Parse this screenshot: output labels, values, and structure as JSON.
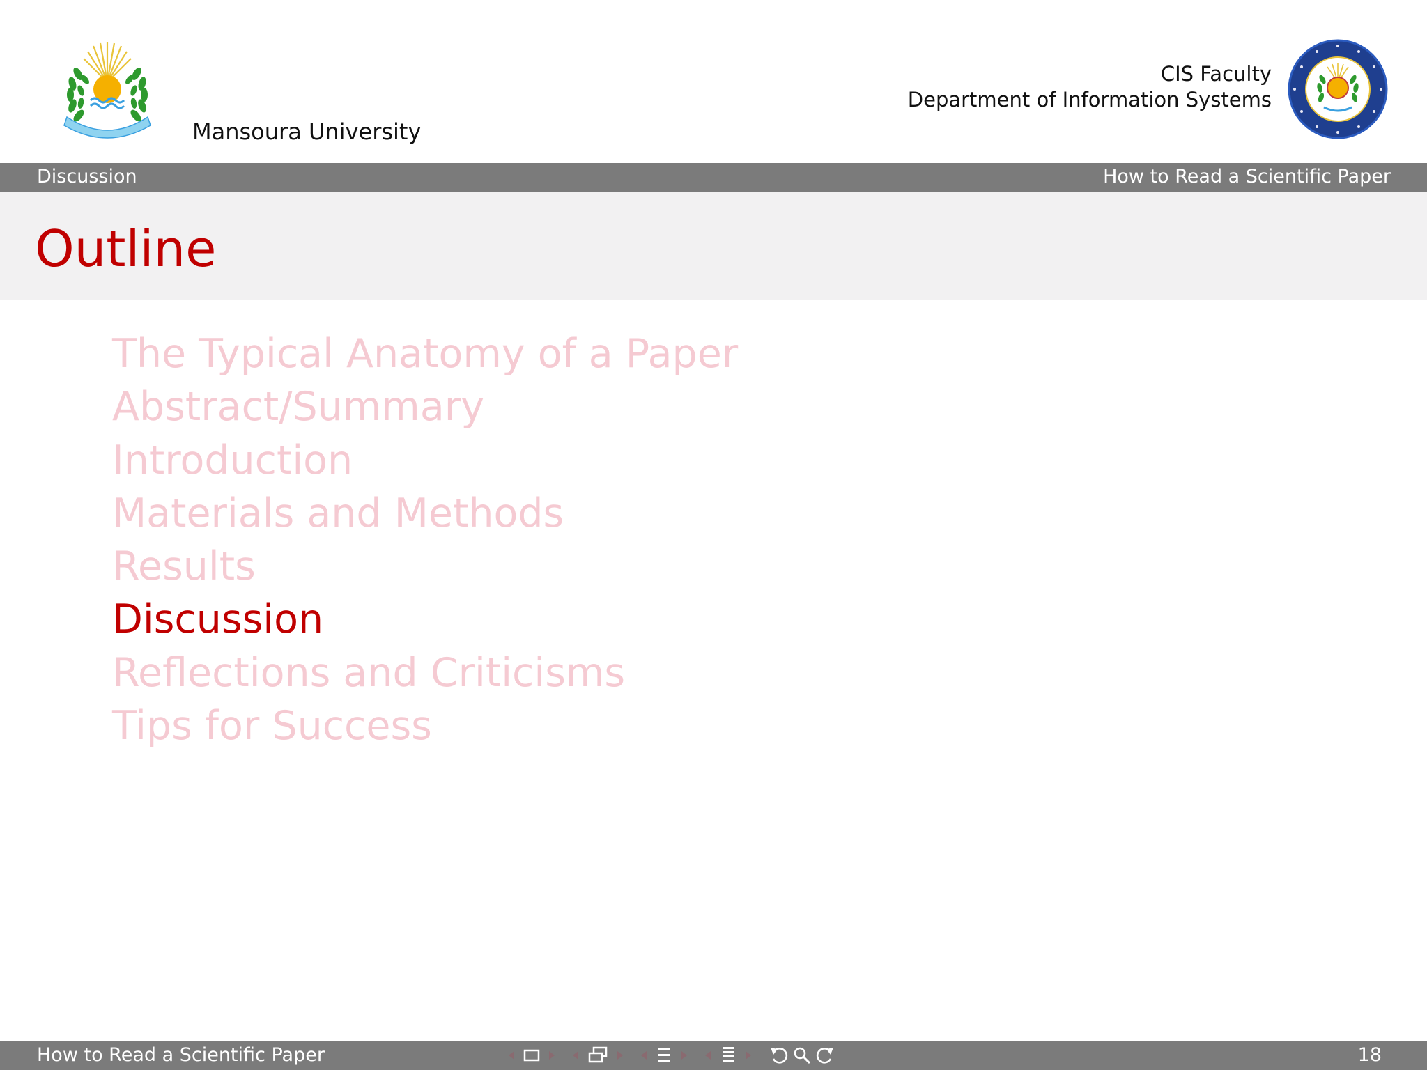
{
  "header": {
    "university_name": "Mansoura University",
    "faculty_name": "CIS Faculty",
    "department_name": "Department of Information Systems",
    "university_logo_icon": "mansoura-university-crest-icon",
    "faculty_logo_icon": "cis-faculty-seal-icon"
  },
  "navbar": {
    "section": "Discussion",
    "presentation_title": "How to Read a Scientific Paper"
  },
  "frame": {
    "title": "Outline"
  },
  "outline": {
    "items": [
      {
        "label": "The Typical Anatomy of a Paper",
        "current": false
      },
      {
        "label": "Abstract/Summary",
        "current": false
      },
      {
        "label": "Introduction",
        "current": false
      },
      {
        "label": "Materials and Methods",
        "current": false
      },
      {
        "label": "Results",
        "current": false
      },
      {
        "label": "Discussion",
        "current": true
      },
      {
        "label": "Reflections and Criticisms",
        "current": false
      },
      {
        "label": "Tips for Success",
        "current": false
      }
    ]
  },
  "footer": {
    "presentation_title": "How to Read a Scientific Paper",
    "page_number": "18",
    "nav_icons": [
      "frame-nav-icon",
      "subsection-nav-icon",
      "section-nav-icon",
      "document-nav-icon",
      "back-icon",
      "search-icon",
      "forward-icon"
    ]
  },
  "colors": {
    "accent": "#c00000",
    "faded_item": "#f5cad2",
    "bar_gray": "#7b7b7b",
    "title_band": "#f2f1f2"
  }
}
